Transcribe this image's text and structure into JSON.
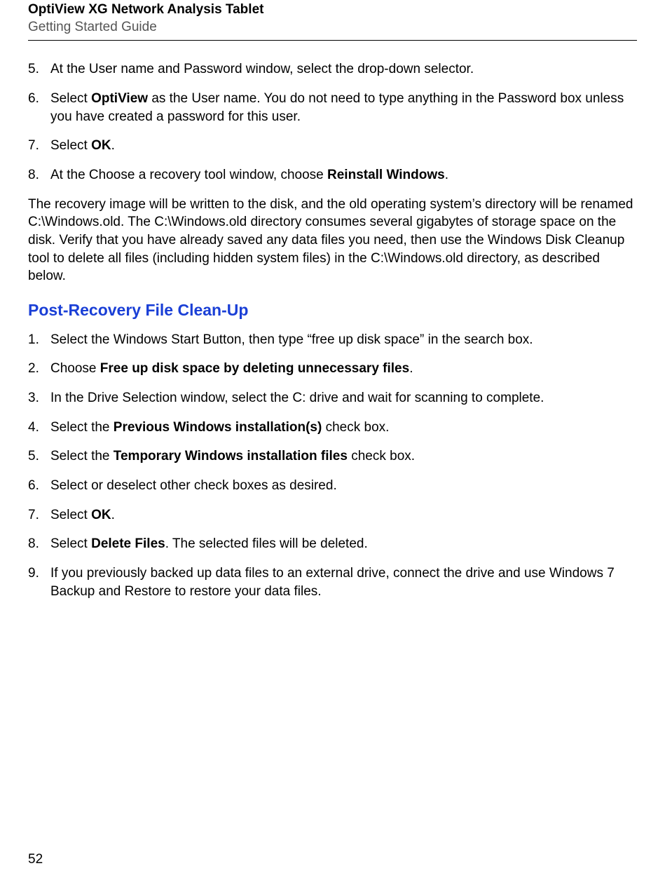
{
  "header": {
    "title": "OptiView XG Network Analysis Tablet",
    "subtitle": "Getting Started Guide"
  },
  "first_list": [
    {
      "num": "5.",
      "before": "At the User name and Password window, select the drop-down selector."
    },
    {
      "num": "6.",
      "before": "Select ",
      "bold1": "OptiView",
      "after1": " as the User name. You do not need to type anything in the Password box unless you have created a password for this user."
    },
    {
      "num": "7.",
      "before": "Select ",
      "bold1": "OK",
      "after1": "."
    },
    {
      "num": "8.",
      "before": "At the Choose a recovery tool window, choose ",
      "bold1": "Reinstall Windows",
      "after1": "."
    }
  ],
  "recovery_para": "The recovery image will be written to the disk, and the old operating system’s directory will be renamed C:\\Windows.old. The C:\\Windows.old directory consumes several gigabytes of storage space on the disk. Verify that you have already saved any data files you need, then use the Windows Disk Cleanup tool to delete all files (including hidden system files) in the C:\\Windows.old directory, as described below.",
  "section_heading": "Post-Recovery File Clean-Up",
  "second_list": [
    {
      "num": "1.",
      "before": "Select the Windows Start Button, then type “free up disk space” in the search box."
    },
    {
      "num": "2.",
      "before": "Choose ",
      "bold1": "Free up disk space by deleting unnecessary files",
      "after1": "."
    },
    {
      "num": "3.",
      "before": "In the Drive Selection window, select the C: drive and wait for scanning to complete."
    },
    {
      "num": "4.",
      "before": "Select the ",
      "bold1": "Previous Windows installation(s)",
      "after1": " check box."
    },
    {
      "num": "5.",
      "before": "Select the ",
      "bold1": "Temporary Windows installation files",
      "after1": " check box."
    },
    {
      "num": "6.",
      "before": "Select or deselect other check boxes as desired."
    },
    {
      "num": "7.",
      "before": "Select ",
      "bold1": "OK",
      "after1": "."
    },
    {
      "num": "8.",
      "before": "Select ",
      "bold1": "Delete Files",
      "after1": ". The selected files will be deleted."
    },
    {
      "num": "9.",
      "before": "If you previously backed up data files to an external drive, connect the drive and use Windows 7 Backup and Restore to restore your data files."
    }
  ],
  "page_number": "52"
}
